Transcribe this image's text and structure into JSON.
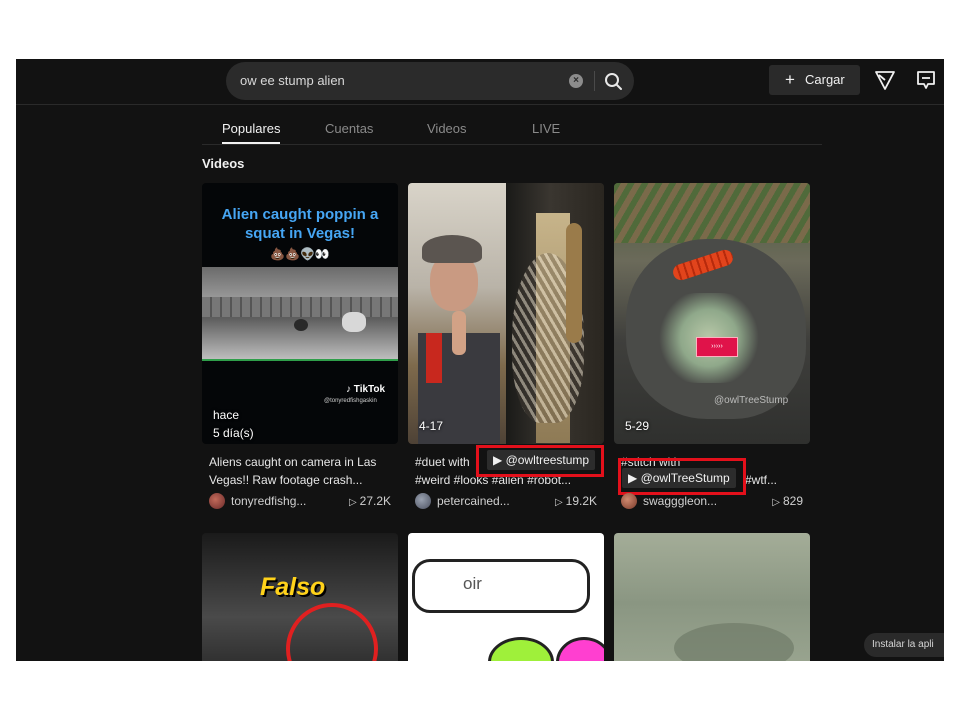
{
  "search": {
    "query": "ow ee stump alien"
  },
  "header": {
    "upload_label": "Cargar"
  },
  "tabs": [
    {
      "label": "Populares",
      "active": true
    },
    {
      "label": "Cuentas",
      "active": false
    },
    {
      "label": "Videos",
      "active": false
    },
    {
      "label": "LIVE",
      "active": false
    }
  ],
  "section_title": "Videos",
  "cards": [
    {
      "overlay_title": "Alien caught poppin a squat in Vegas!",
      "overlay_emoji": "💩💩👽👀",
      "watermark_brand": "TikTok",
      "watermark_user": "@tonyredfishgaskin",
      "date_line1": "hace",
      "date_line2": "5 día(s)",
      "desc_line1": "Aliens caught on camera in Las",
      "desc_line2": "Vegas!! Raw footage crash...",
      "author": "tonyredfishg...",
      "views": "27.2K"
    },
    {
      "date": "4-17",
      "desc_line1": "#duet with",
      "mention": "@owltreestump",
      "desc_line2": "#weird #looks #alien #robot...",
      "author": "petercained...",
      "views": "19.2K"
    },
    {
      "date": "5-29",
      "watermark_user": "@owlTreeStump",
      "desc_line1": "#stitch with",
      "mention": "@owlTreeStump",
      "desc_suffix": "#wtf...",
      "author": "swagggleon...",
      "views": "829"
    }
  ],
  "row2": {
    "card1_text": "Falso",
    "card2_text": "oir"
  },
  "install_label": "Instalar la apli"
}
